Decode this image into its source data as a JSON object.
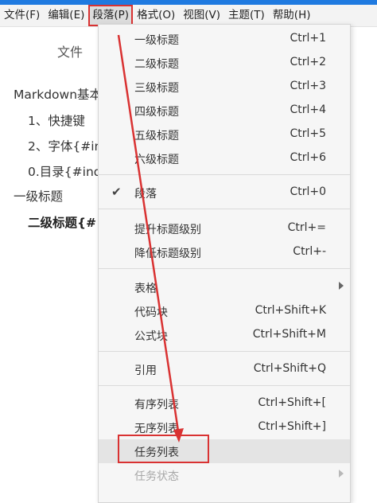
{
  "menubar": {
    "items": [
      "文件(F)",
      "编辑(E)",
      "段落(P)",
      "格式(O)",
      "视图(V)",
      "主题(T)",
      "帮助(H)"
    ],
    "active_index": 2
  },
  "sidebar": {
    "tab_label": "文件",
    "outline": [
      "Markdown基本",
      "1、快捷键",
      "2、字体{#in",
      "0.目录{#ind",
      "一级标题",
      "二级标题{#"
    ]
  },
  "dropdown": {
    "items": [
      {
        "label": "一级标题",
        "shortcut": "Ctrl+1"
      },
      {
        "label": "二级标题",
        "shortcut": "Ctrl+2"
      },
      {
        "label": "三级标题",
        "shortcut": "Ctrl+3"
      },
      {
        "label": "四级标题",
        "shortcut": "Ctrl+4"
      },
      {
        "label": "五级标题",
        "shortcut": "Ctrl+5"
      },
      {
        "label": "六级标题",
        "shortcut": "Ctrl+6"
      },
      {
        "label": "段落",
        "shortcut": "Ctrl+0",
        "checked": true
      },
      {
        "label": "提升标题级别",
        "shortcut": "Ctrl+="
      },
      {
        "label": "降低标题级别",
        "shortcut": "Ctrl+-"
      },
      {
        "label": "表格",
        "submenu": true
      },
      {
        "label": "代码块",
        "shortcut": "Ctrl+Shift+K"
      },
      {
        "label": "公式块",
        "shortcut": "Ctrl+Shift+M"
      },
      {
        "label": "引用",
        "shortcut": "Ctrl+Shift+Q"
      },
      {
        "label": "有序列表",
        "shortcut": "Ctrl+Shift+["
      },
      {
        "label": "无序列表",
        "shortcut": "Ctrl+Shift+]"
      },
      {
        "label": "任务列表",
        "highlighted": true
      },
      {
        "label": "任务状态",
        "submenu": true,
        "disabled": true
      }
    ],
    "check_glyph": "✔"
  },
  "colors": {
    "accent_blue": "#1f7ae0",
    "annotation_red": "#d93232",
    "menu_bg": "#f6f6f6",
    "highlight_bg": "#e4e4e4"
  }
}
